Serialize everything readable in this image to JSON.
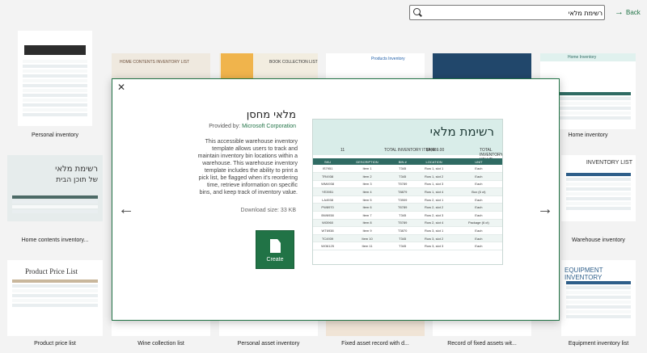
{
  "topbar": {
    "back_label": "Back",
    "search_value": "רשימת מלאי"
  },
  "gallery": {
    "personal_inventory": "Personal inventory",
    "home_inventory": "Home inventory",
    "home_contents_inventory": "Home contents inventory...",
    "warehouse_inventory": "Warehouse inventory",
    "product_price_list": "Product price list",
    "wine_collection_list": "Wine collection list",
    "personal_asset_inventory": "Personal asset inventory",
    "fixed_asset_record": "Fixed asset record with d...",
    "record_fixed_assets": "Record of fixed assets wit...",
    "equipment_inventory": "Equipment inventory list",
    "thumb_home_contents_title": "HOME CONTENTS INVENTORY LIST",
    "thumb_book_collection": "BOOK COLLECTION LIST",
    "thumb_products_inventory": "Products Inventory",
    "thumb_home_inventory": "Home Inventory",
    "thumb_home_title_heb": "רשימת מלאי",
    "thumb_home_sub_heb": "של תוכן הבית",
    "thumb_warehouse_title": "INVENTORY LIST",
    "thumb_product_price": "Product Price List",
    "thumb_equipment": "EQUIPMENT INVENTORY"
  },
  "modal": {
    "title": "מלאי מחסן",
    "provided_by_label": "Provided by:",
    "provider": "Microsoft Corporation",
    "description": "This accessible warehouse inventory template allows users to track and maintain inventory bin locations within a warehouse. This warehouse inventory template includes the ability to print a pick list, be flagged when it's reordering time, retrieve information on specific bins, and keep track of inventory value.",
    "download_size": "Download size: 33 KB",
    "create_label": "Create",
    "preview": {
      "title": "רשימת מלאי",
      "total_value_label": "TOTAL INVENTORY VALUE:",
      "total_value": "$4,469.00",
      "total_items_label": "TOTAL INVENTORY ITEMS:",
      "total_items": "11",
      "headers": [
        "SKU",
        "DESCRIPTION",
        "BIN #",
        "LOCATION",
        "UNIT"
      ],
      "rows": [
        [
          "IS7951",
          "Item 1",
          "T345",
          "Row 1, slot 1",
          "Each"
        ],
        [
          "TR4938",
          "Item 2",
          "T345",
          "Row 1, slot 2",
          "Each"
        ],
        [
          "WM4938",
          "Item 3",
          "T5789",
          "Row 1, slot 3",
          "Each"
        ],
        [
          "YE3951",
          "Item 4",
          "T8879",
          "Row 1, slot 4",
          "Box (6 ct)"
        ],
        [
          "LA4938",
          "Item 5",
          "T3909",
          "Row 2, slot 1",
          "Each"
        ],
        [
          "PW8970",
          "Item 6",
          "T6789",
          "Row 2, slot 2",
          "Each"
        ],
        [
          "BW6938",
          "Item 7",
          "T345",
          "Row 2, slot 3",
          "Each"
        ],
        [
          "WI3960",
          "Item 8",
          "T5789",
          "Row 2, slot 4",
          "Package (6 ct)"
        ],
        [
          "WT6938",
          "Item 9",
          "T3870",
          "Row 3, slot 1",
          "Each"
        ],
        [
          "TC4939",
          "Item 10",
          "T345",
          "Row 3, slot 2",
          "Each"
        ],
        [
          "WO6125",
          "Item 11",
          "T345",
          "Row 3, slot 3",
          "Each"
        ]
      ]
    }
  },
  "colors": {
    "accent": "#217346",
    "preview_header": "#2f6b63"
  }
}
